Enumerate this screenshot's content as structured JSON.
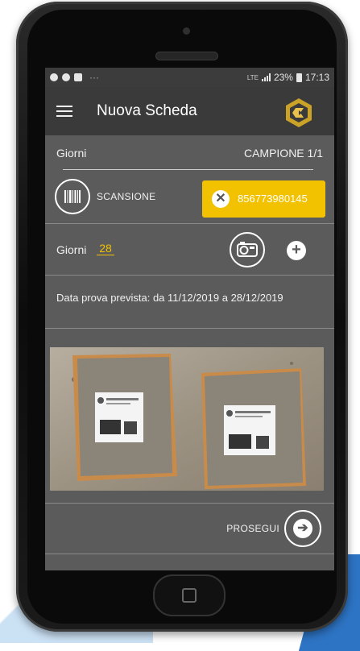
{
  "statusbar": {
    "dots": "···",
    "lte": "LTE",
    "battery_pct": "23%",
    "time": "17:13"
  },
  "appbar": {
    "title": "Nuova Scheda"
  },
  "form": {
    "header_left": "Giorni",
    "header_right": "CAMPIONE 1/1",
    "scan_label": "SCANSIONE",
    "scanned_code": "856773980145",
    "clear_symbol": "✕",
    "days_label": "Giorni",
    "days_value": "28",
    "add_symbol": "+",
    "date_text": "Data prova prevista: da 11/12/2019 a 28/12/2019",
    "next_label": "PROSEGUI",
    "next_symbol": "➔"
  },
  "colors": {
    "accent": "#f2c200",
    "screen_bg": "#5b5b5b",
    "appbar_bg": "#3a3a3a"
  },
  "icons": {
    "menu": "hamburger-icon",
    "logo": "app-logo-icon",
    "barcode": "barcode-icon",
    "clear": "close-icon",
    "camera": "camera-icon",
    "add": "plus-icon",
    "next": "arrow-right-icon"
  }
}
